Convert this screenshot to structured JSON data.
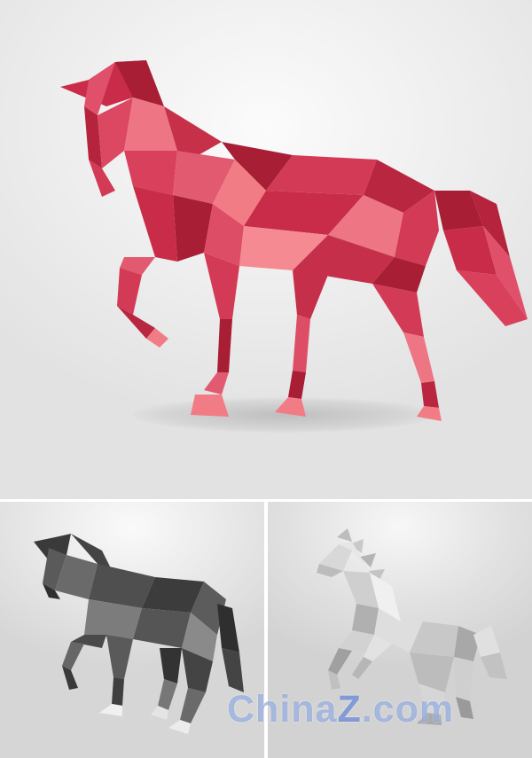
{
  "scene": {
    "description_items": [
      "red-horse",
      "dark-horse",
      "white-horse"
    ]
  },
  "colors": {
    "red_base": "#d33a55",
    "red_dark": "#a81e35",
    "red_light": "#f27c86",
    "dark_base": "#4a4a4a",
    "dark_light": "#8a8a8a",
    "white_base": "#cfcfcf",
    "white_light": "#f2f2f2"
  },
  "watermark": {
    "main": "China",
    "z": "Z",
    "suffix": ".com"
  }
}
